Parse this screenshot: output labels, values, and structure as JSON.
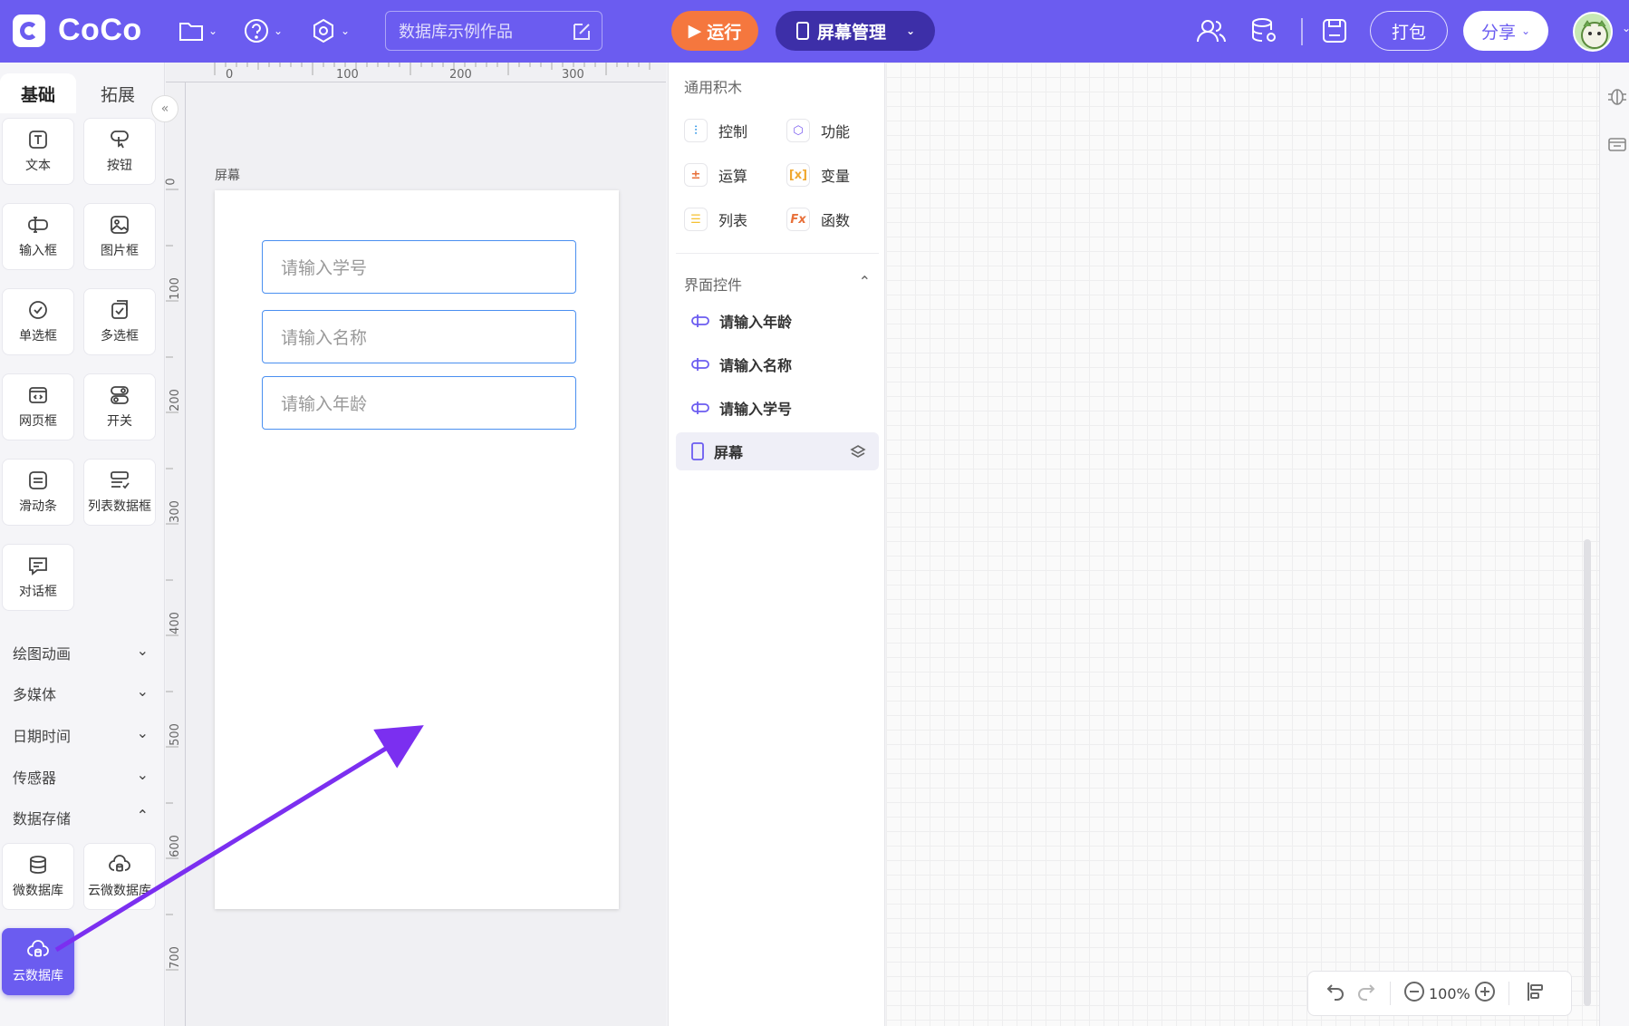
{
  "topbar": {
    "brand": "CoCo",
    "project_name": "数据库示例作品",
    "run_label": "运行",
    "screen_manage_label": "屏幕管理",
    "pack_label": "打包",
    "share_label": "分享"
  },
  "palette": {
    "tabs": [
      "基础",
      "拓展"
    ],
    "components": [
      "文本",
      "按钮",
      "输入框",
      "图片框",
      "单选框",
      "多选框",
      "网页框",
      "开关",
      "滑动条",
      "列表数据框",
      "对话框"
    ],
    "categories": [
      "绘图动画",
      "多媒体",
      "日期时间",
      "传感器",
      "数据存储"
    ],
    "storage_components": [
      "微数据库",
      "云微数据库",
      "云数据库"
    ]
  },
  "ruler": {
    "top_ticks": [
      "0",
      "100",
      "200",
      "300"
    ],
    "left_ticks": [
      "0",
      "100",
      "200",
      "300",
      "400",
      "500",
      "600",
      "700"
    ]
  },
  "canvas": {
    "screen_label": "屏幕",
    "inputs": [
      "请输入学号",
      "请输入名称",
      "请输入年龄"
    ]
  },
  "blocks": {
    "general_heading": "通用积木",
    "general": [
      "控制",
      "功能",
      "运算",
      "变量",
      "列表",
      "函数"
    ],
    "ui_heading": "界面控件",
    "ui_items": [
      "请输入年龄",
      "请输入名称",
      "请输入学号"
    ],
    "screen_item": "屏幕"
  },
  "bottom": {
    "zoom": "100%"
  },
  "colors": {
    "brand": "#6b5cf0",
    "run": "#f5773e",
    "arrow": "#7b2ff0"
  }
}
